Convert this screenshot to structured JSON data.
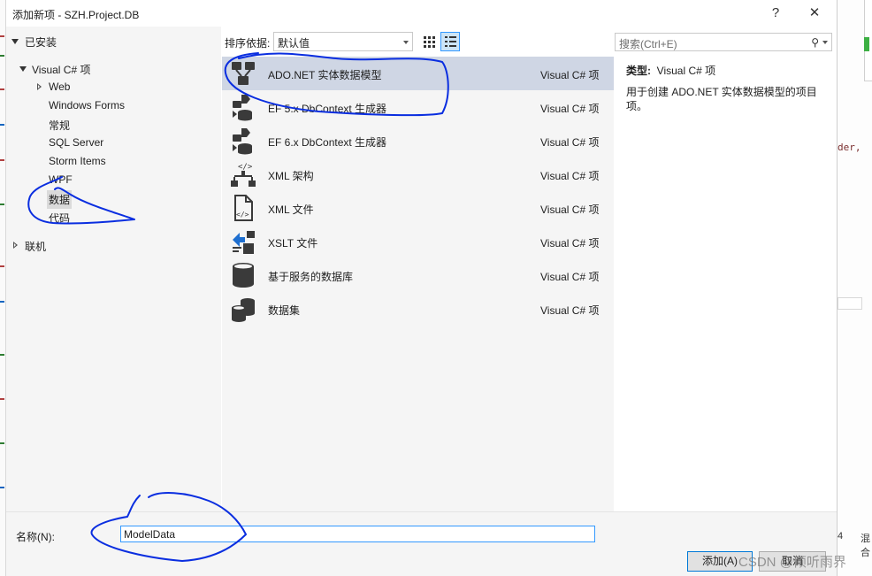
{
  "dialog": {
    "title": "添加新项 - SZH.Project.DB",
    "help_glyph": "?",
    "close_glyph": "✕"
  },
  "tree": {
    "installed": "已安装",
    "visual_csharp": "Visual C# 项",
    "children": [
      "Web",
      "Windows Forms",
      "常规",
      "SQL Server",
      "Storm Items",
      "WPF",
      "数据",
      "代码"
    ],
    "online": "联机"
  },
  "toolbar": {
    "sort_label": "排序依据:",
    "sort_value": "默认值",
    "search_placeholder": "搜索(Ctrl+E)",
    "search_glyph": "⚲"
  },
  "templates": [
    {
      "name": "ADO.NET 实体数据模型",
      "type": "Visual C# 项",
      "icon": "entity-model-icon"
    },
    {
      "name": "EF 5.x DbContext 生成器",
      "type": "Visual C# 项",
      "icon": "dbcontext-generator-icon"
    },
    {
      "name": "EF 6.x DbContext 生成器",
      "type": "Visual C# 项",
      "icon": "dbcontext-generator-icon"
    },
    {
      "name": "XML 架构",
      "type": "Visual C# 项",
      "icon": "xml-schema-icon"
    },
    {
      "name": "XML 文件",
      "type": "Visual C# 项",
      "icon": "xml-file-icon"
    },
    {
      "name": "XSLT 文件",
      "type": "Visual C# 项",
      "icon": "xslt-file-icon"
    },
    {
      "name": "基于服务的数据库",
      "type": "Visual C# 项",
      "icon": "database-icon"
    },
    {
      "name": "数据集",
      "type": "Visual C# 项",
      "icon": "dataset-icon"
    }
  ],
  "details": {
    "type_label": "类型:",
    "type_value": "Visual C# 项",
    "description": "用于创建 ADO.NET 实体数据模型的项目项。"
  },
  "footer": {
    "name_label": "名称(N):",
    "name_value": "ModelData",
    "add_button": "添加(A)",
    "cancel_button": "取消"
  },
  "background": {
    "code_fragment": "der,",
    "status_number": "4",
    "status_text": "混合"
  },
  "watermark": "CSDN @倾听雨界",
  "colors": {
    "selected_row": "#cfd6e4",
    "panel_bg": "#f5f5f5",
    "focus_border": "#3399ff",
    "annotation_ink": "#0a2ee0"
  }
}
